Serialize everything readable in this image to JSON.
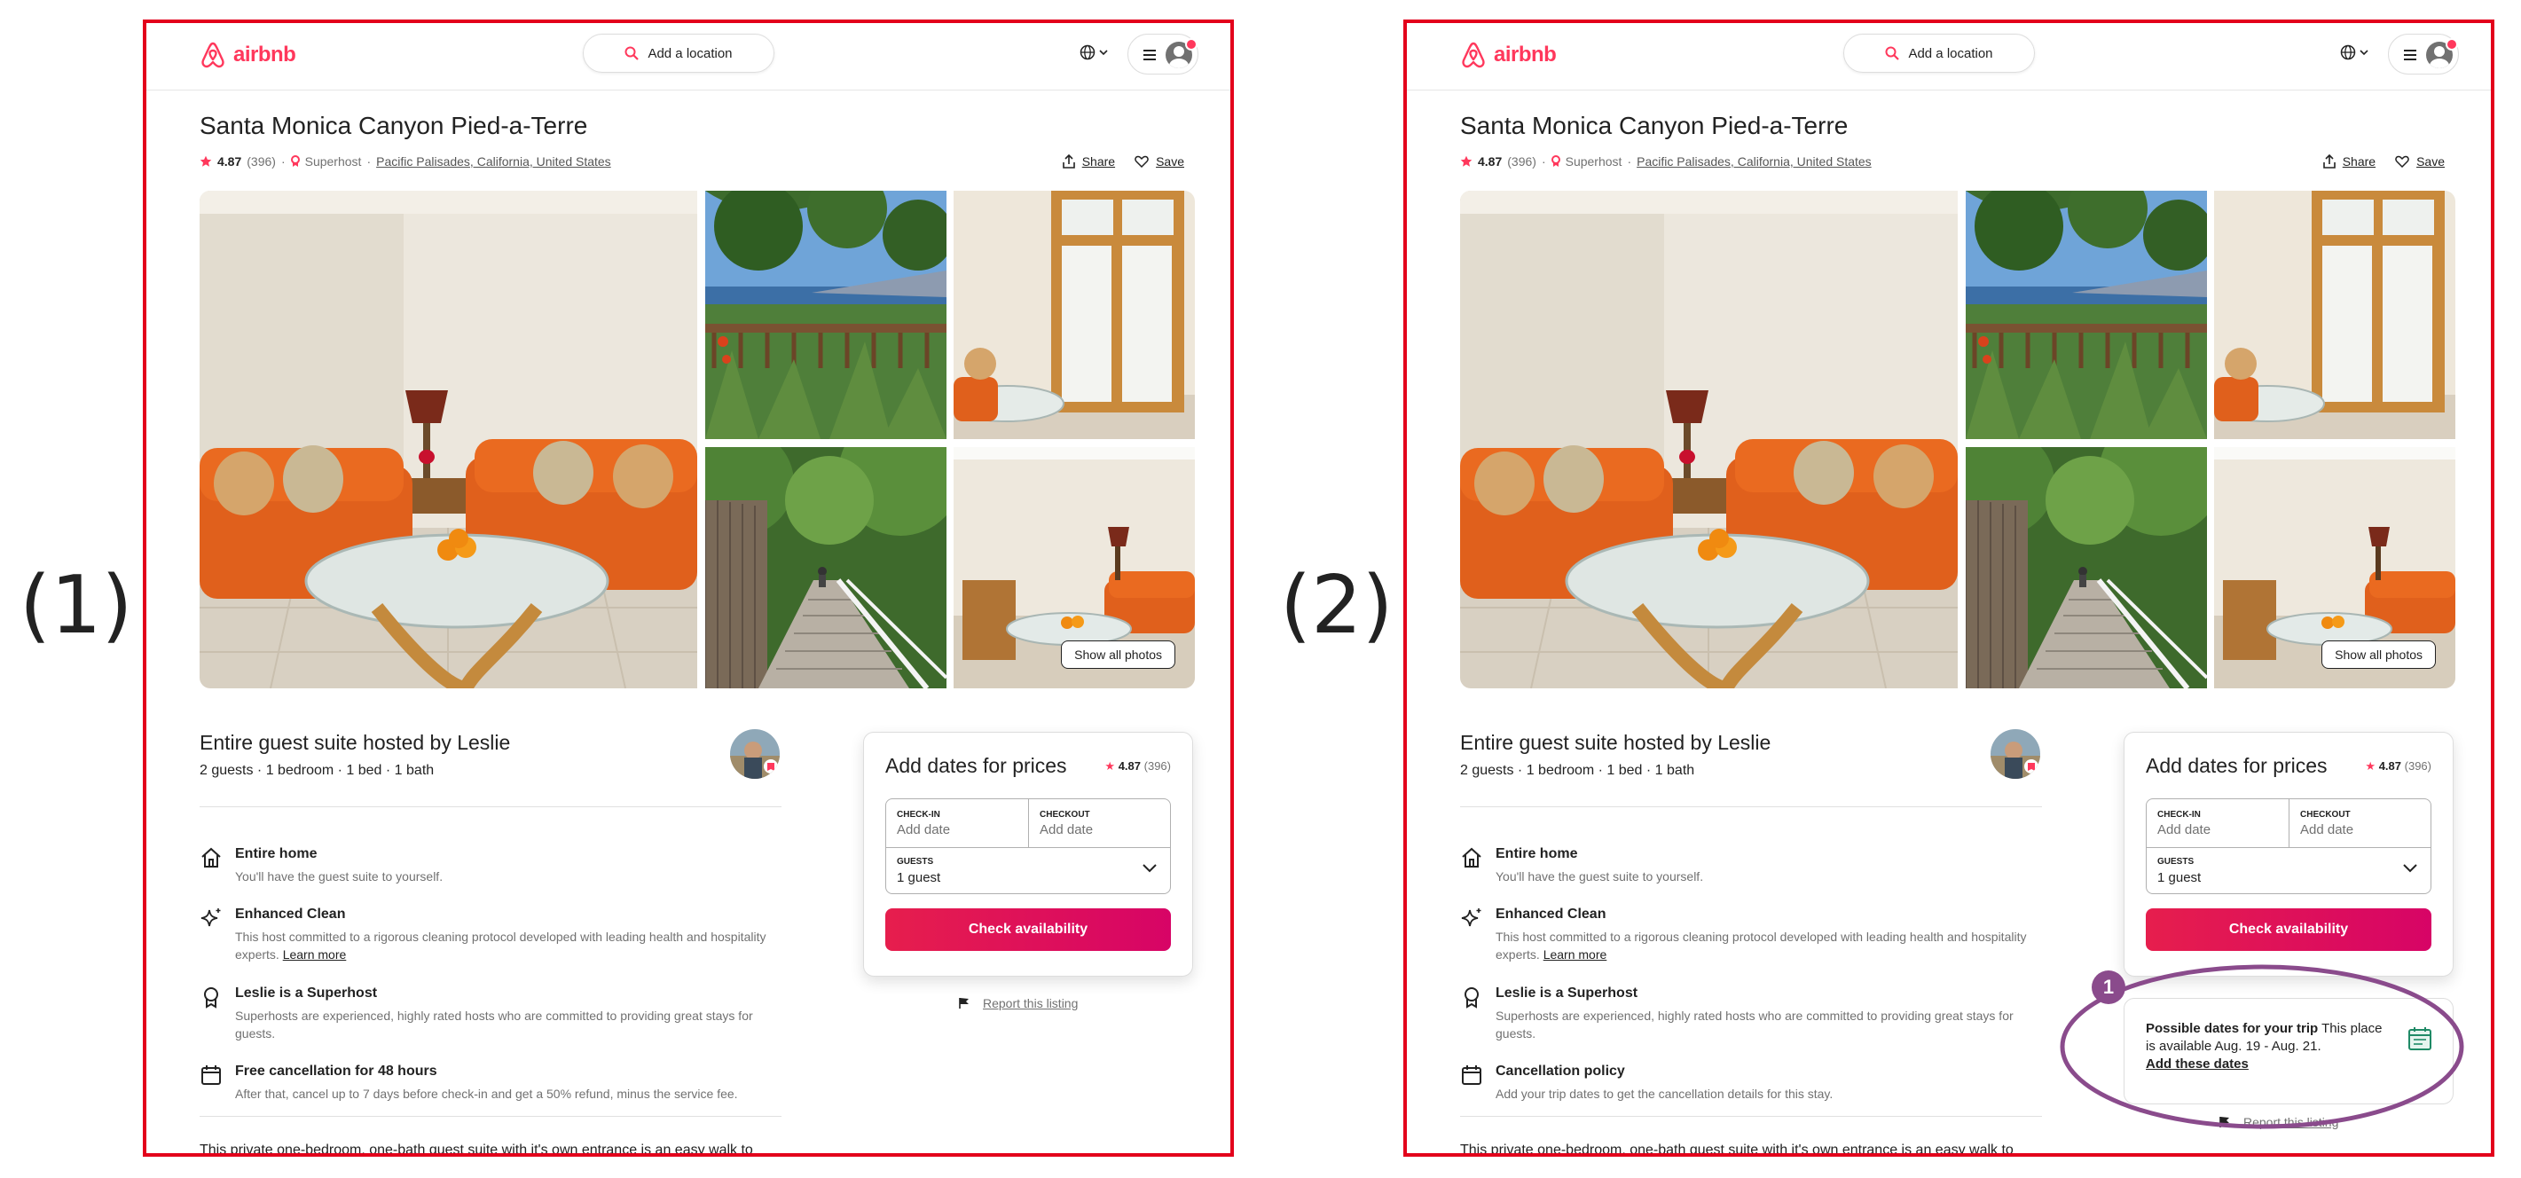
{
  "labels": [
    "(1)",
    "(2)"
  ],
  "header": {
    "logo": "airbnb",
    "search_placeholder": "Add a location"
  },
  "listing": {
    "title": "Santa Monica Canyon Pied-a-Terre",
    "rating": "4.87",
    "reviews": "(396)",
    "superhost": "Superhost",
    "separator": "·",
    "location": "Pacific Palisades, California, United States",
    "share": "Share",
    "save": "Save",
    "show_all_photos": "Show all photos"
  },
  "host": {
    "title": "Entire guest suite hosted by Leslie",
    "subtitle": "2 guests · 1 bedroom · 1 bed · 1 bath"
  },
  "features_common": [
    {
      "title": "Entire home",
      "desc": "You'll have the guest suite to yourself."
    },
    {
      "title": "Enhanced Clean",
      "desc": "This host committed to a rigorous cleaning protocol developed with leading health and hospitality experts.",
      "link": "Learn more"
    },
    {
      "title": "Leslie is a Superhost",
      "desc": "Superhosts are experienced, highly rated hosts who are committed to providing great stays for guests."
    }
  ],
  "feature_last_1": {
    "title": "Free cancellation for 48 hours",
    "desc": "After that, cancel up to 7 days before check-in and get a 50% refund, minus the service fee."
  },
  "feature_last_2": {
    "title": "Cancellation policy",
    "desc": "Add your trip dates to get the cancellation details for this stay."
  },
  "description": "This private one-bedroom, one-bath guest suite with it's own entrance is an easy walk to",
  "booking": {
    "title": "Add dates for prices",
    "rating": "4.87",
    "reviews": "(396)",
    "checkin_label": "CHECK-IN",
    "checkin_value": "Add date",
    "checkout_label": "CHECKOUT",
    "checkout_value": "Add date",
    "guests_label": "GUESTS",
    "guests_value": "1 guest",
    "cta": "Check availability",
    "report": "Report this listing"
  },
  "availability": {
    "title": "Possible dates for your trip",
    "body": "This place is available Aug. 19 - Aug. 21.",
    "link": "Add these dates",
    "badge": "1"
  },
  "colors": {
    "brand": "#FF385C",
    "frame": "#e3001b",
    "annotation": "#8a4b8c"
  }
}
